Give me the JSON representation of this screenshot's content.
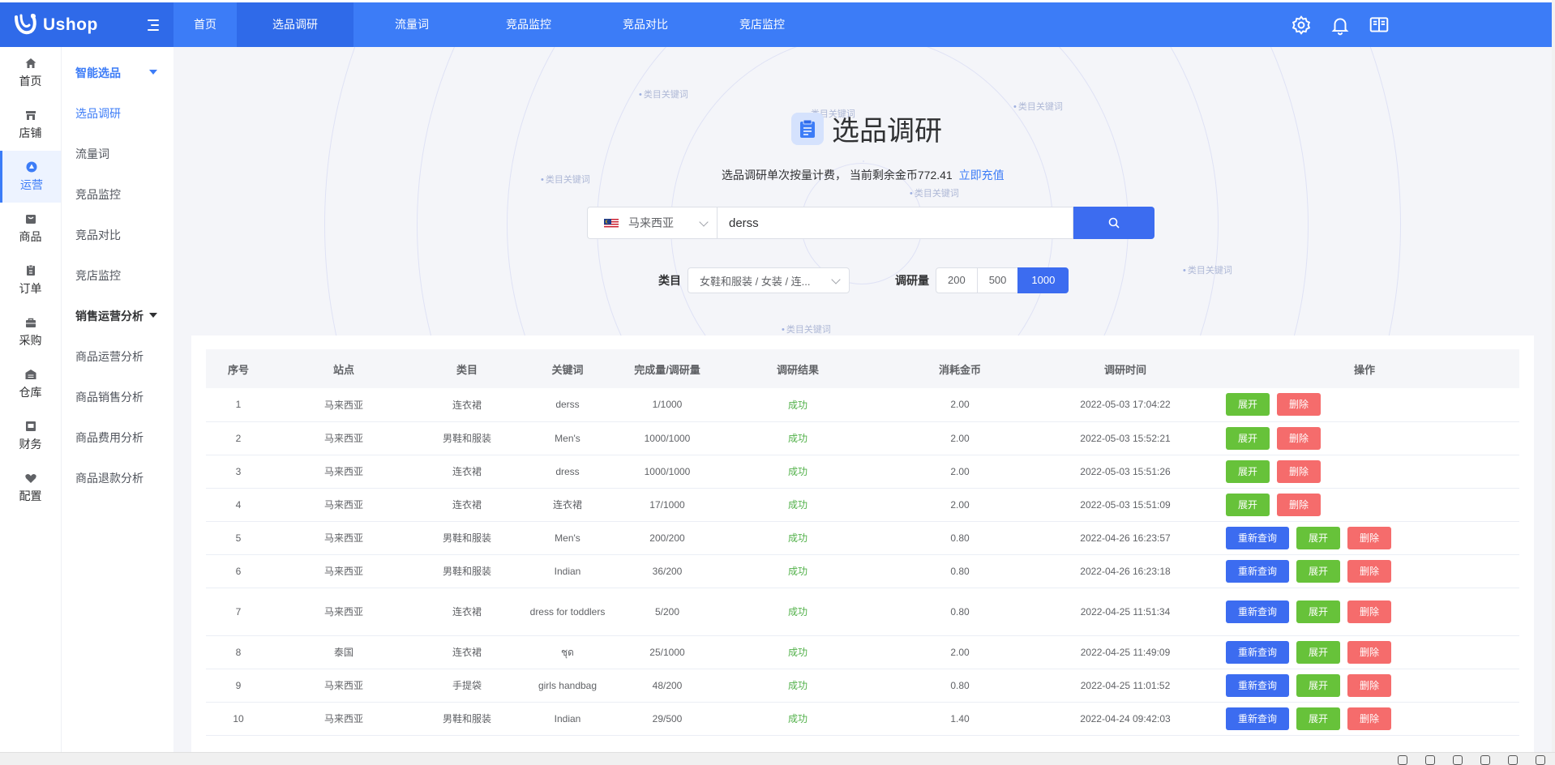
{
  "brand": {
    "name": "Ushop"
  },
  "topnav": [
    {
      "label": "首页",
      "active": false
    },
    {
      "label": "选品调研",
      "active": true
    },
    {
      "label": "流量词",
      "active": false
    },
    {
      "label": "竞品监控",
      "active": false
    },
    {
      "label": "竞品对比",
      "active": false
    },
    {
      "label": "竞店监控",
      "active": false
    }
  ],
  "top_icons": [
    "gear-icon",
    "bell-icon",
    "book-icon"
  ],
  "rail": [
    {
      "label": "首页",
      "icon": "home-icon"
    },
    {
      "label": "店铺",
      "icon": "store-icon"
    },
    {
      "label": "运营",
      "icon": "operations-icon",
      "active": true
    },
    {
      "label": "商品",
      "icon": "product-icon"
    },
    {
      "label": "订单",
      "icon": "order-icon"
    },
    {
      "label": "采购",
      "icon": "purchase-icon"
    },
    {
      "label": "仓库",
      "icon": "warehouse-icon"
    },
    {
      "label": "财务",
      "icon": "finance-icon"
    },
    {
      "label": "配置",
      "icon": "config-icon"
    }
  ],
  "submenu": {
    "group1": "智能选品",
    "items1": [
      "选品调研",
      "流量词",
      "竞品监控",
      "竞品对比",
      "竞店监控"
    ],
    "group2": "销售运营分析",
    "items2": [
      "商品运营分析",
      "商品销售分析",
      "商品费用分析",
      "商品退款分析"
    ]
  },
  "hero": {
    "title": "选品调研",
    "subtitle_prefix": "选品调研单次按量计费， 当前剩余金币",
    "coins": "772.41",
    "recharge": "立即充值",
    "bg_keyword": "类目关键词"
  },
  "search": {
    "country": "马来西亚",
    "query": "derss",
    "category_label": "类目",
    "category_value": "女鞋和服装 / 女装 / 连...",
    "qty_label": "调研量",
    "qty_options": [
      "200",
      "500",
      "1000"
    ],
    "qty_selected": "1000"
  },
  "table": {
    "headers": [
      "序号",
      "站点",
      "类目",
      "关键词",
      "完成量/调研量",
      "调研结果",
      "消耗金币",
      "调研时间",
      "操作"
    ],
    "actions": {
      "requery": "重新查询",
      "expand": "展开",
      "delete": "删除"
    },
    "rows": [
      {
        "no": "1",
        "site": "马来西亚",
        "category": "连衣裙",
        "keyword": "derss",
        "progress": "1/1000",
        "result": "成功",
        "coins": "2.00",
        "time": "2022-05-03 17:04:22",
        "requery": false
      },
      {
        "no": "2",
        "site": "马来西亚",
        "category": "男鞋和服装",
        "keyword": "Men's",
        "progress": "1000/1000",
        "result": "成功",
        "coins": "2.00",
        "time": "2022-05-03 15:52:21",
        "requery": false
      },
      {
        "no": "3",
        "site": "马来西亚",
        "category": "连衣裙",
        "keyword": "dress",
        "progress": "1000/1000",
        "result": "成功",
        "coins": "2.00",
        "time": "2022-05-03 15:51:26",
        "requery": false
      },
      {
        "no": "4",
        "site": "马来西亚",
        "category": "连衣裙",
        "keyword": "连衣裙",
        "progress": "17/1000",
        "result": "成功",
        "coins": "2.00",
        "time": "2022-05-03 15:51:09",
        "requery": false
      },
      {
        "no": "5",
        "site": "马来西亚",
        "category": "男鞋和服装",
        "keyword": "Men's",
        "progress": "200/200",
        "result": "成功",
        "coins": "0.80",
        "time": "2022-04-26 16:23:57",
        "requery": true
      },
      {
        "no": "6",
        "site": "马来西亚",
        "category": "男鞋和服装",
        "keyword": "Indian",
        "progress": "36/200",
        "result": "成功",
        "coins": "0.80",
        "time": "2022-04-26 16:23:18",
        "requery": true
      },
      {
        "no": "7",
        "site": "马来西亚",
        "category": "连衣裙",
        "keyword": "dress for toddlers",
        "progress": "5/200",
        "result": "成功",
        "coins": "0.80",
        "time": "2022-04-25 11:51:34",
        "requery": true
      },
      {
        "no": "8",
        "site": "泰国",
        "category": "连衣裙",
        "keyword": "ชุด",
        "progress": "25/1000",
        "result": "成功",
        "coins": "2.00",
        "time": "2022-04-25 11:49:09",
        "requery": true
      },
      {
        "no": "9",
        "site": "马来西亚",
        "category": "手提袋",
        "keyword": "girls handbag",
        "progress": "48/200",
        "result": "成功",
        "coins": "0.80",
        "time": "2022-04-25 11:01:52",
        "requery": true
      },
      {
        "no": "10",
        "site": "马来西亚",
        "category": "男鞋和服装",
        "keyword": "Indian",
        "progress": "29/500",
        "result": "成功",
        "coins": "1.40",
        "time": "2022-04-24 09:42:03",
        "requery": true
      }
    ]
  },
  "colors": {
    "primary": "#3c7cf7",
    "success": "#67c23a",
    "danger": "#f56c6c",
    "result_text": "#52b14a"
  }
}
